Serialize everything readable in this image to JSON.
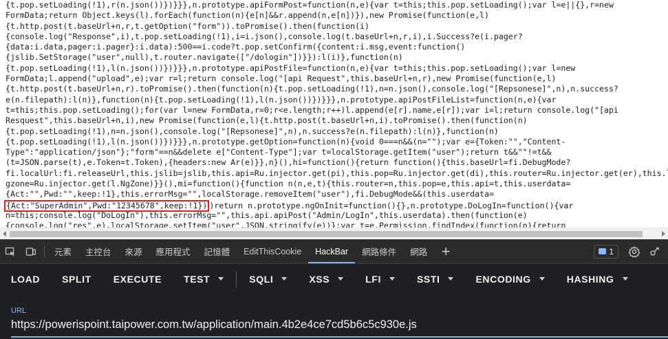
{
  "code_lines": [
    "{t.pop.setLoading(!1),r(n.json())})}}},n.prototype.apiFormPost=function(n,e){var t=this;this.pop.setLoading();var l=e||{},r=new",
    "FormData;return Object.keys(l).forEach(function(n){e[n]&&r.append(n,e[n])}),new Promise(function(e,l)",
    "{t.http.post(t.baseUrl+n,r,t.getOption(\"form\")).toPromise().then(function(i)",
    "{console.log(\"Response\",i),t.pop.setLoading(!1),i=i.json(),console.log(t.baseUrl+n,r,i),i.Success?e(i.pager?",
    "{data:i.data,pager:i.pager}:i.data):500==i.code?t.pop.setConfirm({content:i.msg,event:function()",
    "{jslib.SetStorage(\"user\",null),t.router.navigate([\"/dologin\"])}}):l(i)},function(n)",
    "{t.pop.setLoading(!1),l(n.json())})}}},n.prototype.apiPostFile=function(n,e){var t=this;this.pop.setLoading();var l=new",
    "FormData;l.append(\"upload\",e);var r=l;return console.log(\"[api Request\",this.baseUrl+n,r),new Promise(function(e,l)",
    "{t.http.post(t.baseUrl+n,r).toPromise().then(function(n){t.pop.setLoading(!1),n=n.json(),console.log(\"[Repsonese]\",n),n.success?",
    "e(n.filepath):l(n)},function(n){t.pop.setLoading(!1),l(n.json())})}}},n.prototype.apiPostFileList=function(n,e){var",
    "t=this;this.pop.setLoading();for(var l=new FormData,r=0;r<e.length;r++)l.append(e[r].name,e[r]);var i=l;return console.log(\"[api",
    "Resquest\",this.baseUrl+n,i),new Promise(function(e,l){t.http.post(t.baseUrl+n,i).toPromise().then(function(n)",
    "{t.pop.setLoading(!1),n=n.json(),console.log(\"[Repsonese]\",n),n.success?e(n.filepath):l(n)},function(n)",
    "{t.pop.setLoading(!1),l(n.json())})}}},n.prototype.getOption=function(n){void 0===n&&(n=\"\");var e={Token:\"\",\"Content-",
    "Type\":\"application/json\"};\"form\"==n&&delete e[\"Content-Type\"];var t=localStorage.getItem(\"user\");return t&&\"\"!=t&&",
    "(t=JSON.parse(t),e.Token=t.Token),{headers:new Ar(e)}},n}(),hi=function(){return function(){this.baseUrl=fi.DebugMode?",
    "fi.localUrl:fi.releaseUrl,this.jslib=jslib,this.api=Ru.injector.get(pi),this.pop=Ru.injector.get(di),this.router=Ru.injector.get(er),this.lan",
    "gzone=Ru.injector.get(l.NgZone)}}(),mi=function(){function n(n,e,t){this.router=n,this.pop=e,this.api=t,this.userdata=",
    "{Act:\"\",Pwd:\"\",keep:!1},this.errorMsg=\"\",localStorage.removeItem(\"user\"),fi.DebugMode&&(this.userdata=",
    "",
    "n=this;console.log(\"DoLogIn\"),this.errorMsg=\"\",this.api.apiPost(\"Admin/LogIn\",this.userdata).then(function(e)",
    "{console.log(\"res\",e),localStorage.setItem(\"user\",JSON.stringify(e))};var t=e.Permission.findIndex(function(n){return"
  ],
  "highlight": {
    "text": "{Act:\"SuperAdmin\",Pwd:\"12345678\",keep:!1})",
    "rest": ")return n.prototype.ngOnInit=function(){},n.prototype.DoLogIn=function(){var",
    "color": "#e02020"
  },
  "devtools": {
    "tabs": [
      {
        "label": "元素",
        "active": false
      },
      {
        "label": "主控台",
        "active": false
      },
      {
        "label": "來源",
        "active": false
      },
      {
        "label": "應用程式",
        "active": false
      },
      {
        "label": "記憶體",
        "active": false
      },
      {
        "label": "EditThisCookie",
        "active": false
      },
      {
        "label": "HackBar",
        "active": true
      },
      {
        "label": "網路條件",
        "active": false
      },
      {
        "label": "網路",
        "active": false
      }
    ],
    "issues_count": "1",
    "accent": "#8ab4f8"
  },
  "hackbar": {
    "buttons": [
      {
        "label": "LOAD",
        "dropdown": false
      },
      {
        "label": "SPLIT",
        "dropdown": false
      },
      {
        "label": "EXECUTE",
        "dropdown": false
      },
      {
        "label": "TEST",
        "dropdown": true
      },
      {
        "label": "SQLI",
        "dropdown": true
      },
      {
        "label": "XSS",
        "dropdown": true
      },
      {
        "label": "LFI",
        "dropdown": true
      },
      {
        "label": "SSTI",
        "dropdown": true
      },
      {
        "label": "ENCODING",
        "dropdown": true
      },
      {
        "label": "HASHING",
        "dropdown": true
      }
    ],
    "url_label": "URL",
    "url_value": "https://powerispoint.taipower.com.tw/application/main.4b2e4ce7cd5b6c5c930e.js"
  }
}
